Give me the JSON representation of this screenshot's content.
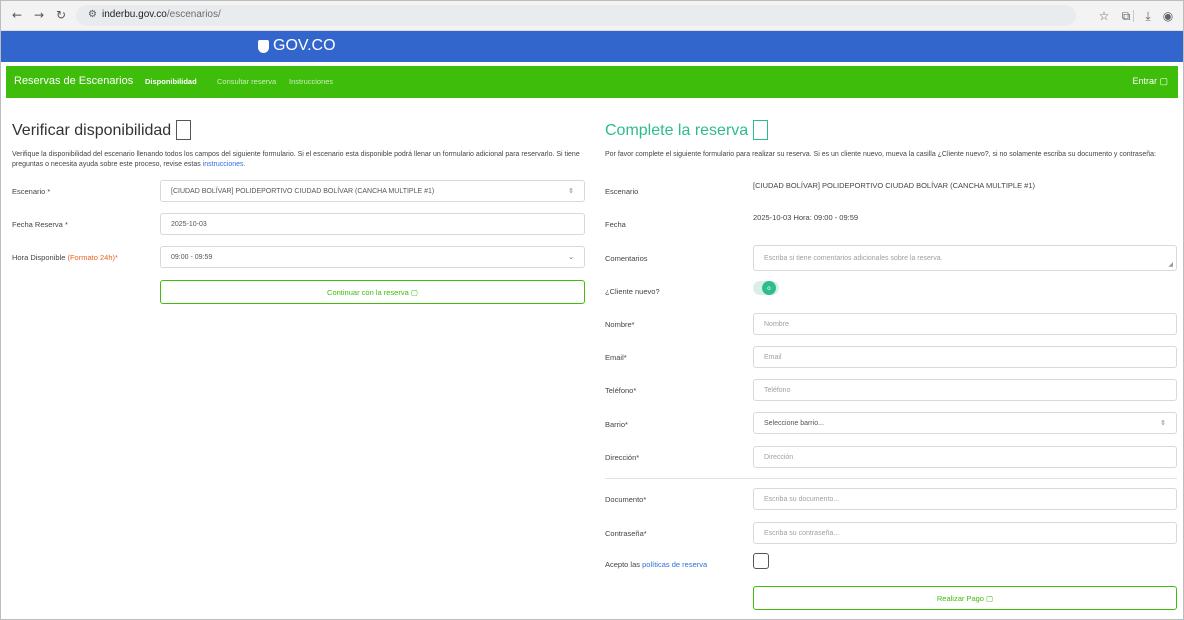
{
  "browser": {
    "url_host": "inderbu.gov.co",
    "url_path": "/escenarios/"
  },
  "gov_bar": {
    "logo_text": "GOV.CO"
  },
  "nav": {
    "brand": "Reservas de Escenarios",
    "links": [
      "Disponibilidad",
      "Consultar reserva",
      "Instrucciones"
    ],
    "login": "Entrar"
  },
  "left": {
    "title": "Verificar disponibilidad",
    "desc_part1": "Verifique la disponibilidad del escenario llenando todos los campos del siguiente formulario. Si el escenario esta disponible podrá llenar un formulario adicional para reservarlo. Si tiene preguntas o necesita ayuda sobre este proceso, revise estas",
    "desc_link": "instrucciones.",
    "escenario_label": "Escenario *",
    "escenario_value": "[CIUDAD BOLÍVAR] POLIDEPORTIVO CIUDAD BOLÍVAR (CANCHA MULTIPLE #1)",
    "fecha_label": "Fecha Reserva *",
    "fecha_value": "2025-10-03",
    "hora_label": "Hora Disponible",
    "hora_format": "(Formato 24h)*",
    "hora_value": "09:00 - 09:59",
    "continue_button": "Continuar con la reserva"
  },
  "right": {
    "title": "Complete la reserva",
    "desc": "Por favor complete el siguiente formulario para realizar su reserva. Si es un cliente nuevo, mueva la casilla ¿Cliente nuevo?, si no solamente escriba su documento y contraseña:",
    "escenario_label": "Escenario",
    "escenario_value": "[CIUDAD BOLÍVAR] POLIDEPORTIVO CIUDAD BOLÍVAR (CANCHA MULTIPLE #1)",
    "fecha_label": "Fecha",
    "fecha_value": "2025-10-03 Hora: 09:00 - 09:59",
    "comentarios_label": "Comentarios",
    "comentarios_placeholder": "Escriba si tiene comentarios adicionales sobre la reserva.",
    "cliente_label": "¿Cliente nuevo?",
    "cliente_nuevo": true,
    "nombre_label": "Nombre*",
    "nombre_placeholder": "Nombre",
    "email_label": "Email*",
    "email_placeholder": "Email",
    "telefono_label": "Teléfono*",
    "telefono_placeholder": "Teléfono",
    "barrio_label": "Barrio*",
    "barrio_value": "Seleccione barrio...",
    "direccion_label": "Dirección*",
    "direccion_placeholder": "Dirección",
    "documento_label": "Documento*",
    "documento_placeholder": "Escriba su documento...",
    "contrasena_label": "Contraseña*",
    "contrasena_placeholder": "Escriba su contraseña...",
    "acepto_text": "Acepto las",
    "politicas_link": "políticas de reserva",
    "pay_button": "Realizar Pago"
  }
}
